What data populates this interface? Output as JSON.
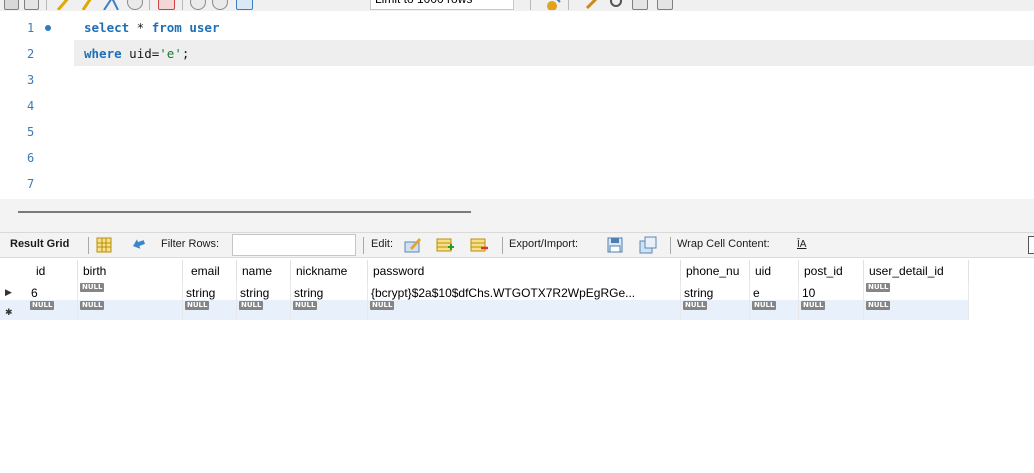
{
  "toolbar": {
    "limit_label": "Limit to 1000 rows"
  },
  "editor": {
    "lines": [
      {
        "num": "1",
        "parts": [
          {
            "kind": "kw",
            "text": "select"
          },
          {
            "kind": "plain",
            "text": " * "
          },
          {
            "kind": "kw",
            "text": "from"
          },
          {
            "kind": "plain",
            "text": " "
          },
          {
            "kind": "kw",
            "text": "user"
          }
        ]
      },
      {
        "num": "2",
        "parts": [
          {
            "kind": "kw",
            "text": "where"
          },
          {
            "kind": "plain",
            "text": " uid="
          },
          {
            "kind": "str",
            "text": "'e'"
          },
          {
            "kind": "plain",
            "text": ";"
          }
        ]
      },
      {
        "num": "3",
        "parts": []
      },
      {
        "num": "4",
        "parts": []
      },
      {
        "num": "5",
        "parts": []
      },
      {
        "num": "6",
        "parts": []
      },
      {
        "num": "7",
        "parts": []
      }
    ]
  },
  "result_toolbar": {
    "result_grid_label": "Result Grid",
    "filter_rows_label": "Filter Rows:",
    "filter_value": "",
    "edit_label": "Edit:",
    "export_label": "Export/Import:",
    "wrap_label": "Wrap Cell Content:",
    "wrap_icon_text": "ĪA"
  },
  "grid": {
    "columns": [
      "id",
      "birth",
      "email",
      "name",
      "nickname",
      "password",
      "phone_nu",
      "uid",
      "post_id",
      "user_detail_id"
    ],
    "rows": [
      {
        "marker": "▶",
        "values": [
          "6",
          null,
          "string",
          "string",
          "string",
          "{bcrypt}$2a$10$dfChs.WTGOTX7R2WpEgRGe...",
          "string",
          "e",
          "10",
          null
        ]
      },
      {
        "marker": "✱",
        "values": [
          null,
          null,
          null,
          null,
          null,
          null,
          null,
          null,
          null,
          null
        ]
      }
    ],
    "null_label": "NULL"
  },
  "colors": {
    "keyword": "#1e6fb6",
    "string": "#1a7a2e",
    "line_number": "#3a7bb8",
    "active_line": "#eeeeee",
    "new_row": "#e8f0fb"
  }
}
